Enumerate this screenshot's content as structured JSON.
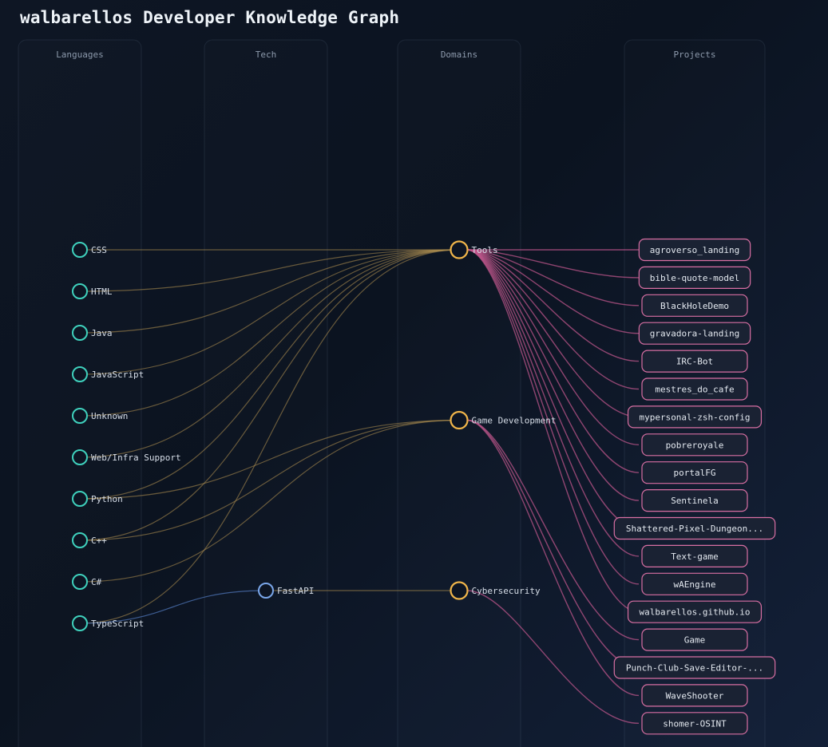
{
  "title": "walbarellos Developer Knowledge Graph",
  "columns": {
    "languages": "Languages",
    "tech": "Tech",
    "domains": "Domains",
    "projects": "Projects"
  },
  "colors": {
    "language": "#3fd1bd",
    "tech": "#7aa7ea",
    "domain": "#f0b54a",
    "project": "#d86fa3"
  },
  "languages": [
    "CSS",
    "HTML",
    "Java",
    "JavaScript",
    "Unknown",
    "Web/Infra Support",
    "Python",
    "C++",
    "C#",
    "TypeScript"
  ],
  "tech": [
    "FastAPI"
  ],
  "domains": [
    "Tools",
    "Game Development",
    "Cybersecurity"
  ],
  "projects": [
    "agroverso_landing",
    "bible-quote-model",
    "BlackHoleDemo",
    "gravadora-landing",
    "IRC-Bot",
    "mestres_do_cafe",
    "mypersonal-zsh-config",
    "pobreroyale",
    "portalFG",
    "Sentinela",
    "Shattered-Pixel-Dungeon...",
    "Text-game",
    "wAEngine",
    "walbarellos.github.io",
    "Game",
    "Punch-Club-Save-Editor-...",
    "WaveShooter",
    "shomer-OSINT"
  ],
  "edges": {
    "language_domain": [
      [
        "CSS",
        "Tools"
      ],
      [
        "HTML",
        "Tools"
      ],
      [
        "Java",
        "Tools"
      ],
      [
        "JavaScript",
        "Tools"
      ],
      [
        "Unknown",
        "Tools"
      ],
      [
        "Web/Infra Support",
        "Tools"
      ],
      [
        "Python",
        "Tools"
      ],
      [
        "Python",
        "Game Development"
      ],
      [
        "C++",
        "Tools"
      ],
      [
        "C++",
        "Game Development"
      ],
      [
        "C#",
        "Game Development"
      ],
      [
        "TypeScript",
        "Tools"
      ]
    ],
    "language_tech": [
      [
        "TypeScript",
        "FastAPI"
      ]
    ],
    "tech_domain": [
      [
        "FastAPI",
        "Cybersecurity"
      ]
    ],
    "domain_project": [
      [
        "Tools",
        "agroverso_landing"
      ],
      [
        "Tools",
        "bible-quote-model"
      ],
      [
        "Tools",
        "BlackHoleDemo"
      ],
      [
        "Tools",
        "gravadora-landing"
      ],
      [
        "Tools",
        "IRC-Bot"
      ],
      [
        "Tools",
        "mestres_do_cafe"
      ],
      [
        "Tools",
        "mypersonal-zsh-config"
      ],
      [
        "Tools",
        "pobreroyale"
      ],
      [
        "Tools",
        "portalFG"
      ],
      [
        "Tools",
        "Sentinela"
      ],
      [
        "Tools",
        "Shattered-Pixel-Dungeon..."
      ],
      [
        "Tools",
        "Text-game"
      ],
      [
        "Tools",
        "wAEngine"
      ],
      [
        "Tools",
        "walbarellos.github.io"
      ],
      [
        "Game Development",
        "Game"
      ],
      [
        "Game Development",
        "Punch-Club-Save-Editor-..."
      ],
      [
        "Game Development",
        "WaveShooter"
      ],
      [
        "Cybersecurity",
        "shomer-OSINT"
      ]
    ]
  }
}
